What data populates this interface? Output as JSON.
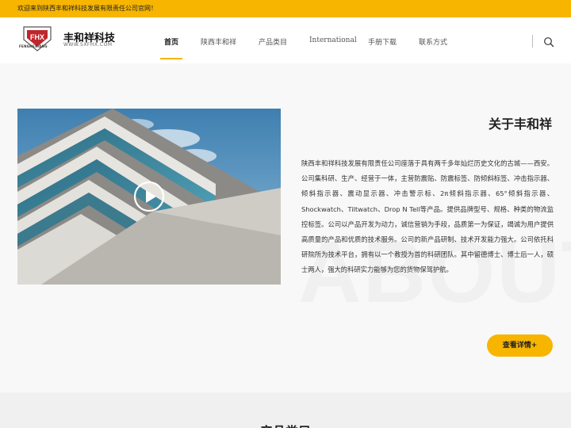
{
  "topbar": {
    "welcome": "欢迎来到陕西丰和祥科技发展有限责任公司官网！"
  },
  "brand": {
    "logo_text": "FHX",
    "logo_sub": "FENGHEXIANG",
    "name": "丰和祥科技",
    "url": "WWW.SXFHX.COM"
  },
  "nav": {
    "items": [
      {
        "label": "首页"
      },
      {
        "label": "陕西丰和祥"
      },
      {
        "label": "产品类目"
      },
      {
        "label": "International"
      },
      {
        "label": "手册下载"
      },
      {
        "label": "联系方式"
      }
    ],
    "active_index": 0,
    "search_icon": "search-icon"
  },
  "about": {
    "title": "关于丰和祥",
    "body": "陕西丰和祥科技发展有限责任公司座落于具有两千多年灿烂历史文化的古城——西安。公司集科研、生产、经营于一体，主营防震贴、防震标签、防倾斜标签、冲击指示器、倾斜指示器、震动显示器、冲击警示标、2π倾斜指示器、65°倾斜指示器、Shockwatch、Tiltwatch、Drop N Tell等产品。提供品牌型号、规格、种类的物流监控标签。公司以产品开发为动力，诚信营销为手段，品质第一为保证，竭诚为用户提供高质量的产品和优质的技术服务。公司的新产品研制、技术开发能力强大。公司依托科研院所为技术平台，拥有以一个教授为首的科研团队。其中留德博士、博士后一人，硕士两人，强大的科研实力能够为您的货物保驾护航。",
    "watermark": "ABOUT",
    "more_label": "查看详情+",
    "video_icon": "play-icon"
  },
  "products": {
    "title": "产品类目"
  },
  "colors": {
    "accent": "#f7b500",
    "logo_red": "#c0262d"
  }
}
